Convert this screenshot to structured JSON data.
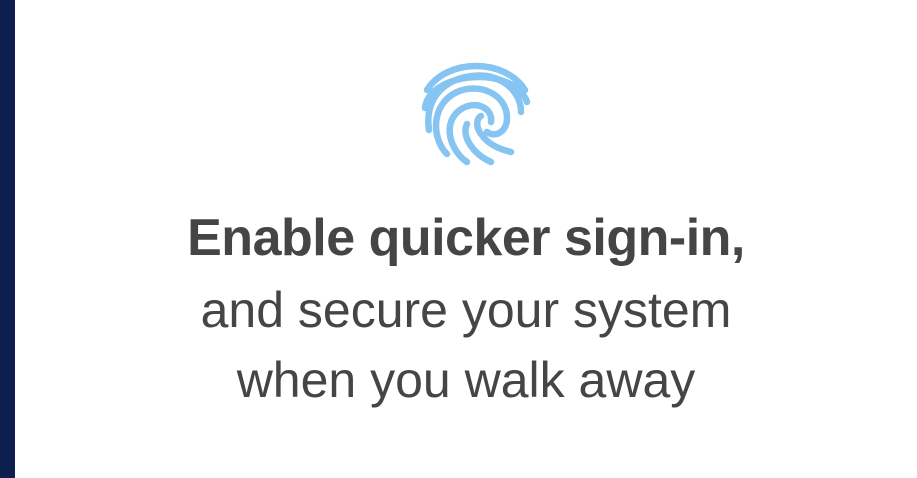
{
  "colors": {
    "side_strip": "#0d1f4f",
    "accent": "#86c4f1",
    "text": "#454545",
    "background": "#ffffff"
  },
  "icon": "fingerprint-icon",
  "promo": {
    "headline_bold": "Enable quicker sign-in,",
    "headline_line2": "and secure your system",
    "headline_line3": "when you walk away"
  }
}
